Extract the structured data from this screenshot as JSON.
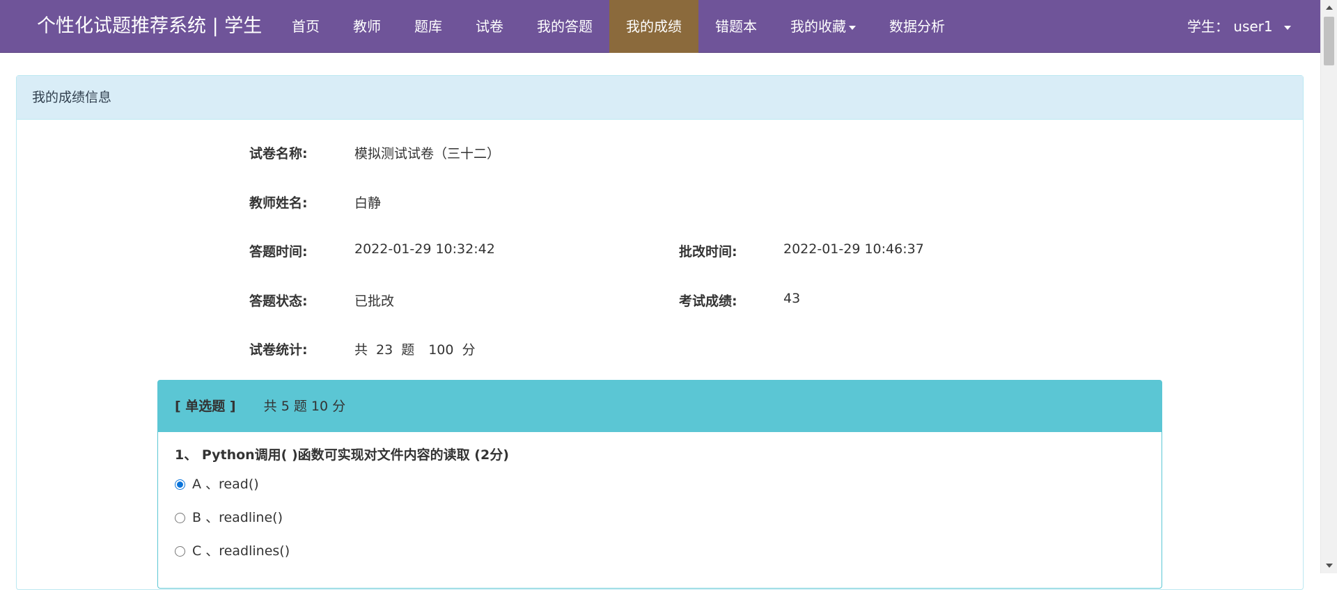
{
  "navbar": {
    "brand": "个性化试题推荐系统 | 学生",
    "items": [
      {
        "label": "首页"
      },
      {
        "label": "教师"
      },
      {
        "label": "题库"
      },
      {
        "label": "试卷"
      },
      {
        "label": "我的答题"
      },
      {
        "label": "我的成绩"
      },
      {
        "label": "错题本"
      },
      {
        "label": "我的收藏"
      },
      {
        "label": "数据分析"
      }
    ],
    "active_item": "我的成绩",
    "user_label": "学生：",
    "user_name": "user1",
    "accent_color": "#6f5499",
    "active_color": "#8b6a3c"
  },
  "panel": {
    "heading": "我的成绩信息",
    "paper_name_label": "试卷名称:",
    "paper_name": "模拟测试试卷（三十二）",
    "teacher_label": "教师姓名:",
    "teacher": "白静",
    "answer_time_label": "答题时间:",
    "answer_time": "2022-01-29 10:32:42",
    "review_time_label": "批改时间:",
    "review_time": "2022-01-29 10:46:37",
    "status_label": "答题状态:",
    "status": "已批改",
    "score_label": "考试成绩:",
    "score": "43",
    "stats_label": "试卷统计:",
    "stats": {
      "prefix": "共",
      "question_count": "23",
      "question_unit": "题",
      "total_score": "100",
      "score_unit": "分"
    }
  },
  "section": {
    "type": "[ 单选题 ]",
    "summary": "共 5 题  10 分",
    "color": "#5bc6d4",
    "question": {
      "title": "1、 Python调用( )函数可实现对文件内容的读取 (2分)",
      "options": [
        {
          "label": "A 、read()",
          "checked": true
        },
        {
          "label": "B 、readline()",
          "checked": false
        },
        {
          "label": "C 、readlines()",
          "checked": false
        }
      ]
    }
  }
}
